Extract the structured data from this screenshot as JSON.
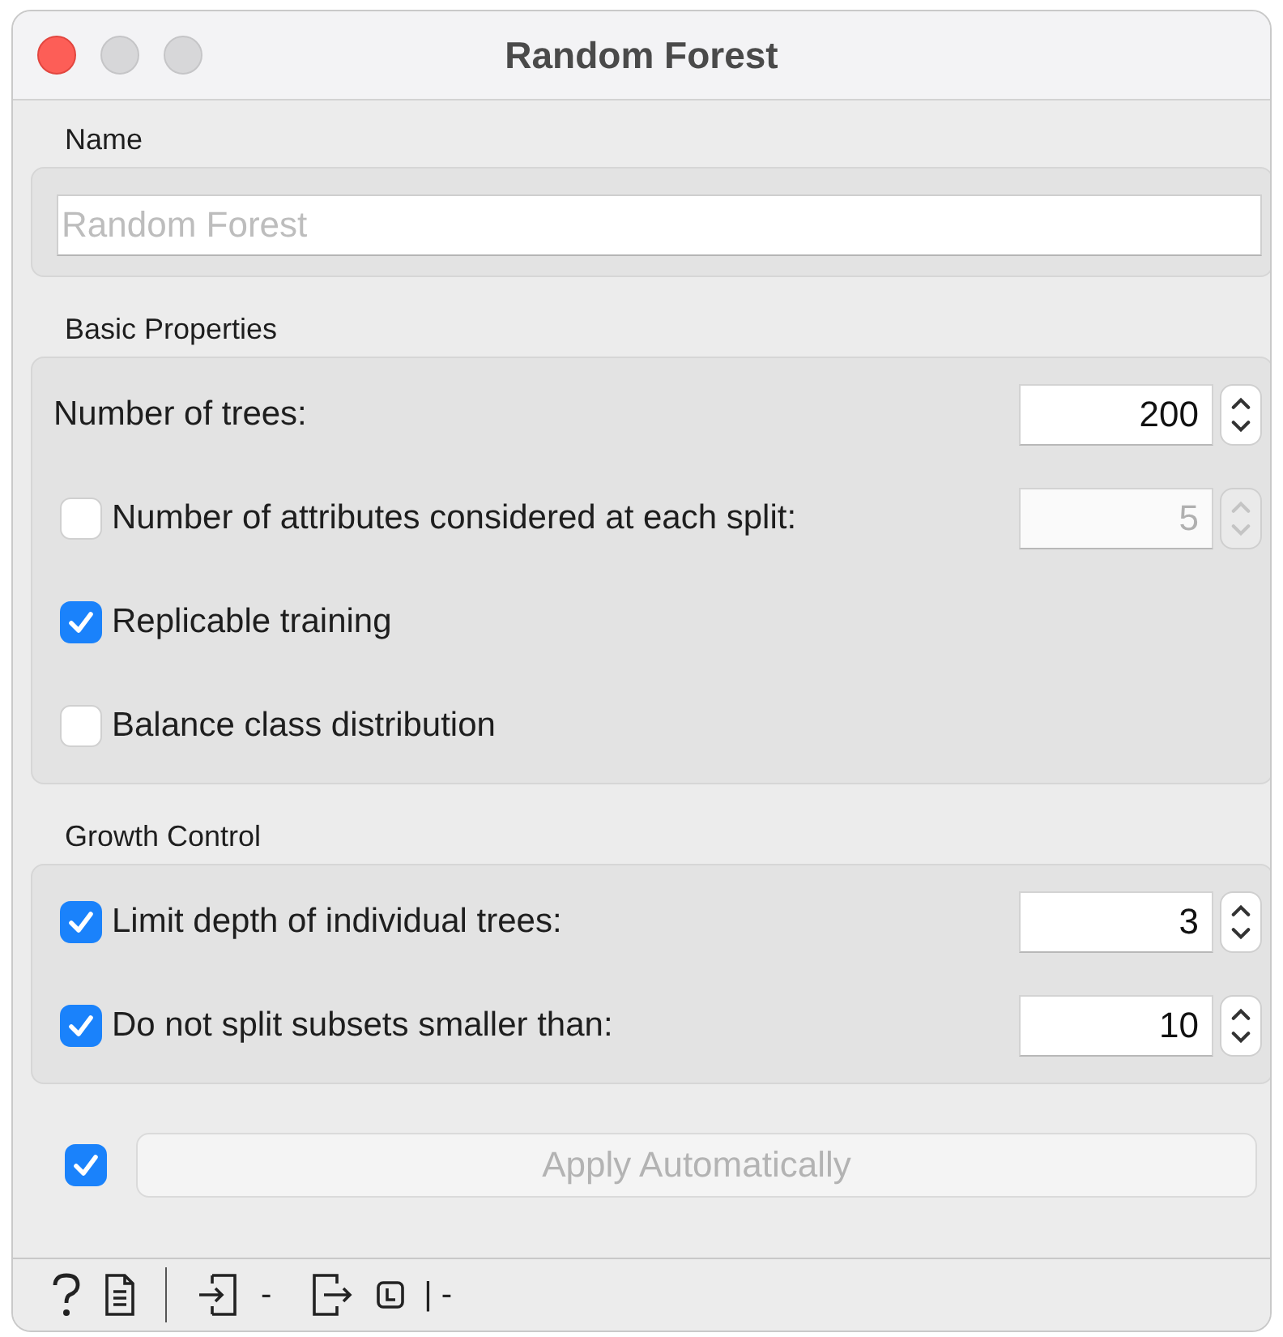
{
  "window": {
    "title": "Random Forest"
  },
  "name_section": {
    "heading": "Name",
    "field": {
      "placeholder": "Random Forest"
    }
  },
  "sections": [
    {
      "heading": "Basic Properties",
      "rows": [
        {
          "kind": "spin",
          "label": "Number of trees:",
          "value": "200",
          "disabled": false
        },
        {
          "kind": "check_spin",
          "label": "Number of attributes considered at each split:",
          "checked": false,
          "value": "5",
          "disabled": true
        },
        {
          "kind": "check",
          "label": "Replicable training",
          "checked": true
        },
        {
          "kind": "check",
          "label": "Balance class distribution",
          "checked": false
        }
      ]
    },
    {
      "heading": "Growth Control",
      "rows": [
        {
          "kind": "check_spin",
          "label": "Limit depth of individual trees:",
          "checked": true,
          "value": "3",
          "disabled": false
        },
        {
          "kind": "check_spin",
          "label": "Do not split subsets smaller than:",
          "checked": true,
          "value": "10",
          "disabled": false
        }
      ]
    }
  ],
  "apply": {
    "checked": true,
    "label": "Apply Automatically",
    "disabled": true
  },
  "status_bar": {
    "input_summary": "-",
    "output_summary": "| -"
  }
}
